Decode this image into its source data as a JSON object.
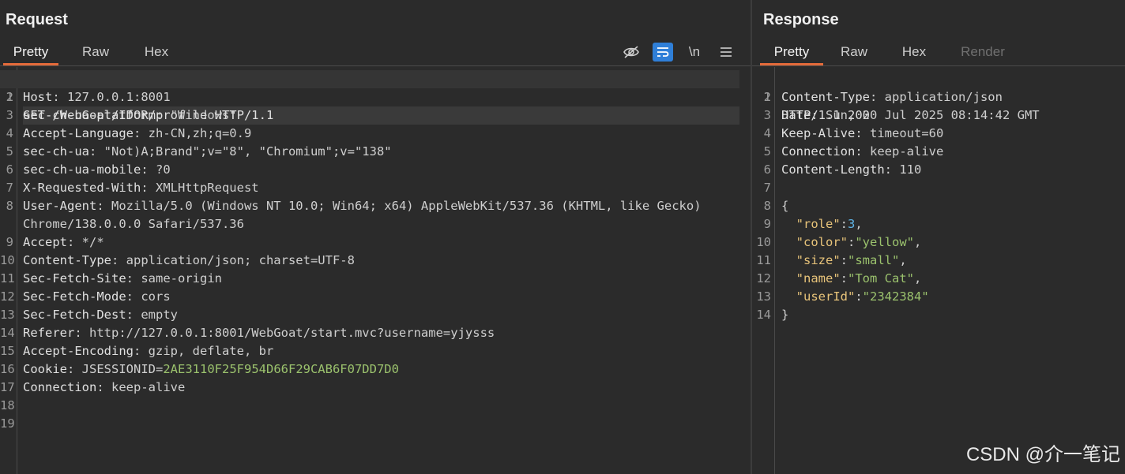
{
  "request": {
    "title": "Request",
    "tabs": [
      "Pretty",
      "Raw",
      "Hex"
    ],
    "toolbar": {
      "newline_label": "\\n"
    },
    "first_line": "GET /WebGoat/IDOR/profile HTTP/1.1",
    "headers": [
      {
        "n": "2",
        "k": "Host",
        "v": "127.0.0.1:8001"
      },
      {
        "n": "3",
        "k": "sec-ch-ua-platform",
        "v": "\"Windows\""
      },
      {
        "n": "4",
        "k": "Accept-Language",
        "v": "zh-CN,zh;q=0.9"
      },
      {
        "n": "5",
        "k": "sec-ch-ua",
        "v": "\"Not)A;Brand\";v=\"8\", \"Chromium\";v=\"138\""
      },
      {
        "n": "6",
        "k": "sec-ch-ua-mobile",
        "v": "?0"
      },
      {
        "n": "7",
        "k": "X-Requested-With",
        "v": "XMLHttpRequest"
      },
      {
        "n": "8",
        "k": "User-Agent",
        "v": "Mozilla/5.0 (Windows NT 10.0; Win64; x64) AppleWebKit/537.36 (KHTML, like Gecko) Chrome/138.0.0.0 Safari/537.36"
      },
      {
        "n": "9",
        "k": "Accept",
        "v": "*/*"
      },
      {
        "n": "10",
        "k": "Content-Type",
        "v": "application/json; charset=UTF-8"
      },
      {
        "n": "11",
        "k": "Sec-Fetch-Site",
        "v": "same-origin"
      },
      {
        "n": "12",
        "k": "Sec-Fetch-Mode",
        "v": "cors"
      },
      {
        "n": "13",
        "k": "Sec-Fetch-Dest",
        "v": "empty"
      },
      {
        "n": "14",
        "k": "Referer",
        "v": "http://127.0.0.1:8001/WebGoat/start.mvc?username=yjysss"
      },
      {
        "n": "15",
        "k": "Accept-Encoding",
        "v": "gzip, deflate, br"
      },
      {
        "n": "16",
        "k": "Cookie",
        "v": "",
        "cookie_name": "JSESSIONID",
        "cookie_value": "2AE3110F25F954D66F29CAB6F07DD7D0"
      },
      {
        "n": "17",
        "k": "Connection",
        "v": "keep-alive"
      }
    ],
    "empty_lines": [
      "18",
      "19"
    ]
  },
  "response": {
    "title": "Response",
    "tabs": [
      "Pretty",
      "Raw",
      "Hex",
      "Render"
    ],
    "status_line": "HTTP/1.1 200",
    "headers": [
      {
        "n": "2",
        "k": "Content-Type",
        "v": "application/json"
      },
      {
        "n": "3",
        "k": "Date",
        "v": "Sun, 20 Jul 2025 08:14:42 GMT"
      },
      {
        "n": "4",
        "k": "Keep-Alive",
        "v": "timeout=60"
      },
      {
        "n": "5",
        "k": "Connection",
        "v": "keep-alive"
      },
      {
        "n": "6",
        "k": "Content-Length",
        "v": "110"
      }
    ],
    "json_lines": [
      {
        "n": "7",
        "type": "blank"
      },
      {
        "n": "8",
        "type": "open",
        "text": "{"
      },
      {
        "n": "9",
        "type": "kv",
        "k": "\"role\"",
        "v": "3",
        "vt": "num",
        "comma": true
      },
      {
        "n": "10",
        "type": "kv",
        "k": "\"color\"",
        "v": "\"yellow\"",
        "vt": "str",
        "comma": true
      },
      {
        "n": "11",
        "type": "kv",
        "k": "\"size\"",
        "v": "\"small\"",
        "vt": "str",
        "comma": true
      },
      {
        "n": "12",
        "type": "kv",
        "k": "\"name\"",
        "v": "\"Tom Cat\"",
        "vt": "str",
        "comma": true
      },
      {
        "n": "13",
        "type": "kv",
        "k": "\"userId\"",
        "v": "\"2342384\"",
        "vt": "str",
        "comma": false
      },
      {
        "n": "14",
        "type": "close",
        "text": "}"
      }
    ]
  },
  "watermark": "CSDN @介一笔记",
  "colors": {
    "accent_tab": "#e56b3a",
    "active_toggle": "#2f7fd8",
    "background": "#2b2b2b"
  }
}
